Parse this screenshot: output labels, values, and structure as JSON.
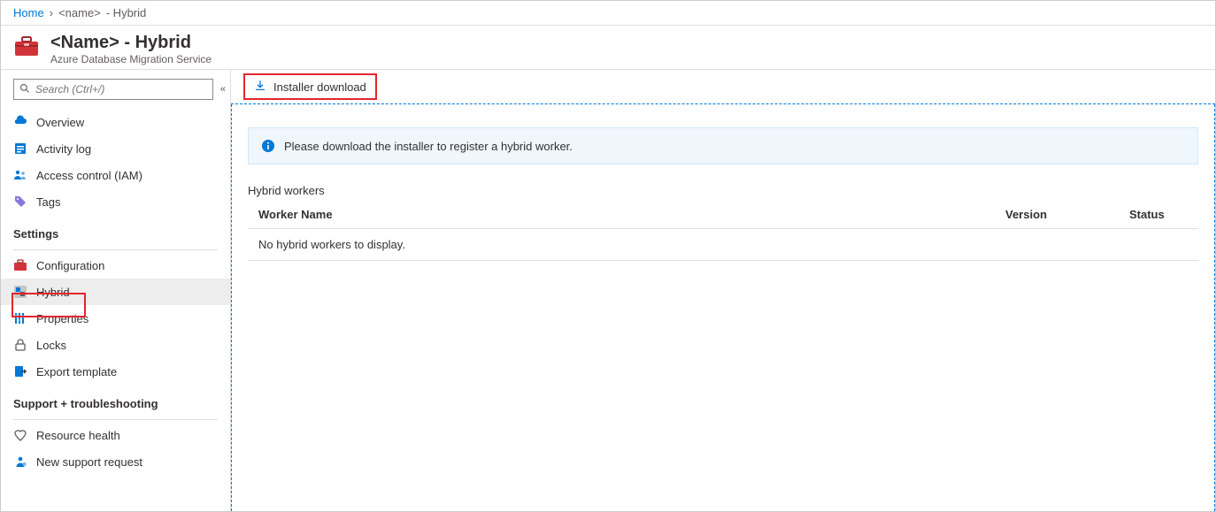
{
  "breadcrumb": {
    "home": "Home",
    "name": "<name>",
    "suffix": "- Hybrid"
  },
  "header": {
    "title": "<Name>     - Hybrid",
    "subtitle": "Azure Database Migration Service"
  },
  "search": {
    "placeholder": "Search (Ctrl+/)"
  },
  "sidebar": {
    "items": [
      {
        "label": "Overview"
      },
      {
        "label": "Activity log"
      },
      {
        "label": "Access control (IAM)"
      },
      {
        "label": "Tags"
      }
    ],
    "settings_title": "Settings",
    "settings_items": [
      {
        "label": "Configuration"
      },
      {
        "label": "Hybrid"
      },
      {
        "label": "Properties"
      },
      {
        "label": "Locks"
      },
      {
        "label": "Export template"
      }
    ],
    "support_title": "Support + troubleshooting",
    "support_items": [
      {
        "label": "Resource health"
      },
      {
        "label": "New support request"
      }
    ]
  },
  "toolbar": {
    "installer_download": "Installer download"
  },
  "info": {
    "message": "Please download the installer to register a hybrid worker."
  },
  "workers": {
    "heading": "Hybrid workers",
    "col_name": "Worker Name",
    "col_version": "Version",
    "col_status": "Status",
    "empty": "No hybrid workers to display."
  }
}
